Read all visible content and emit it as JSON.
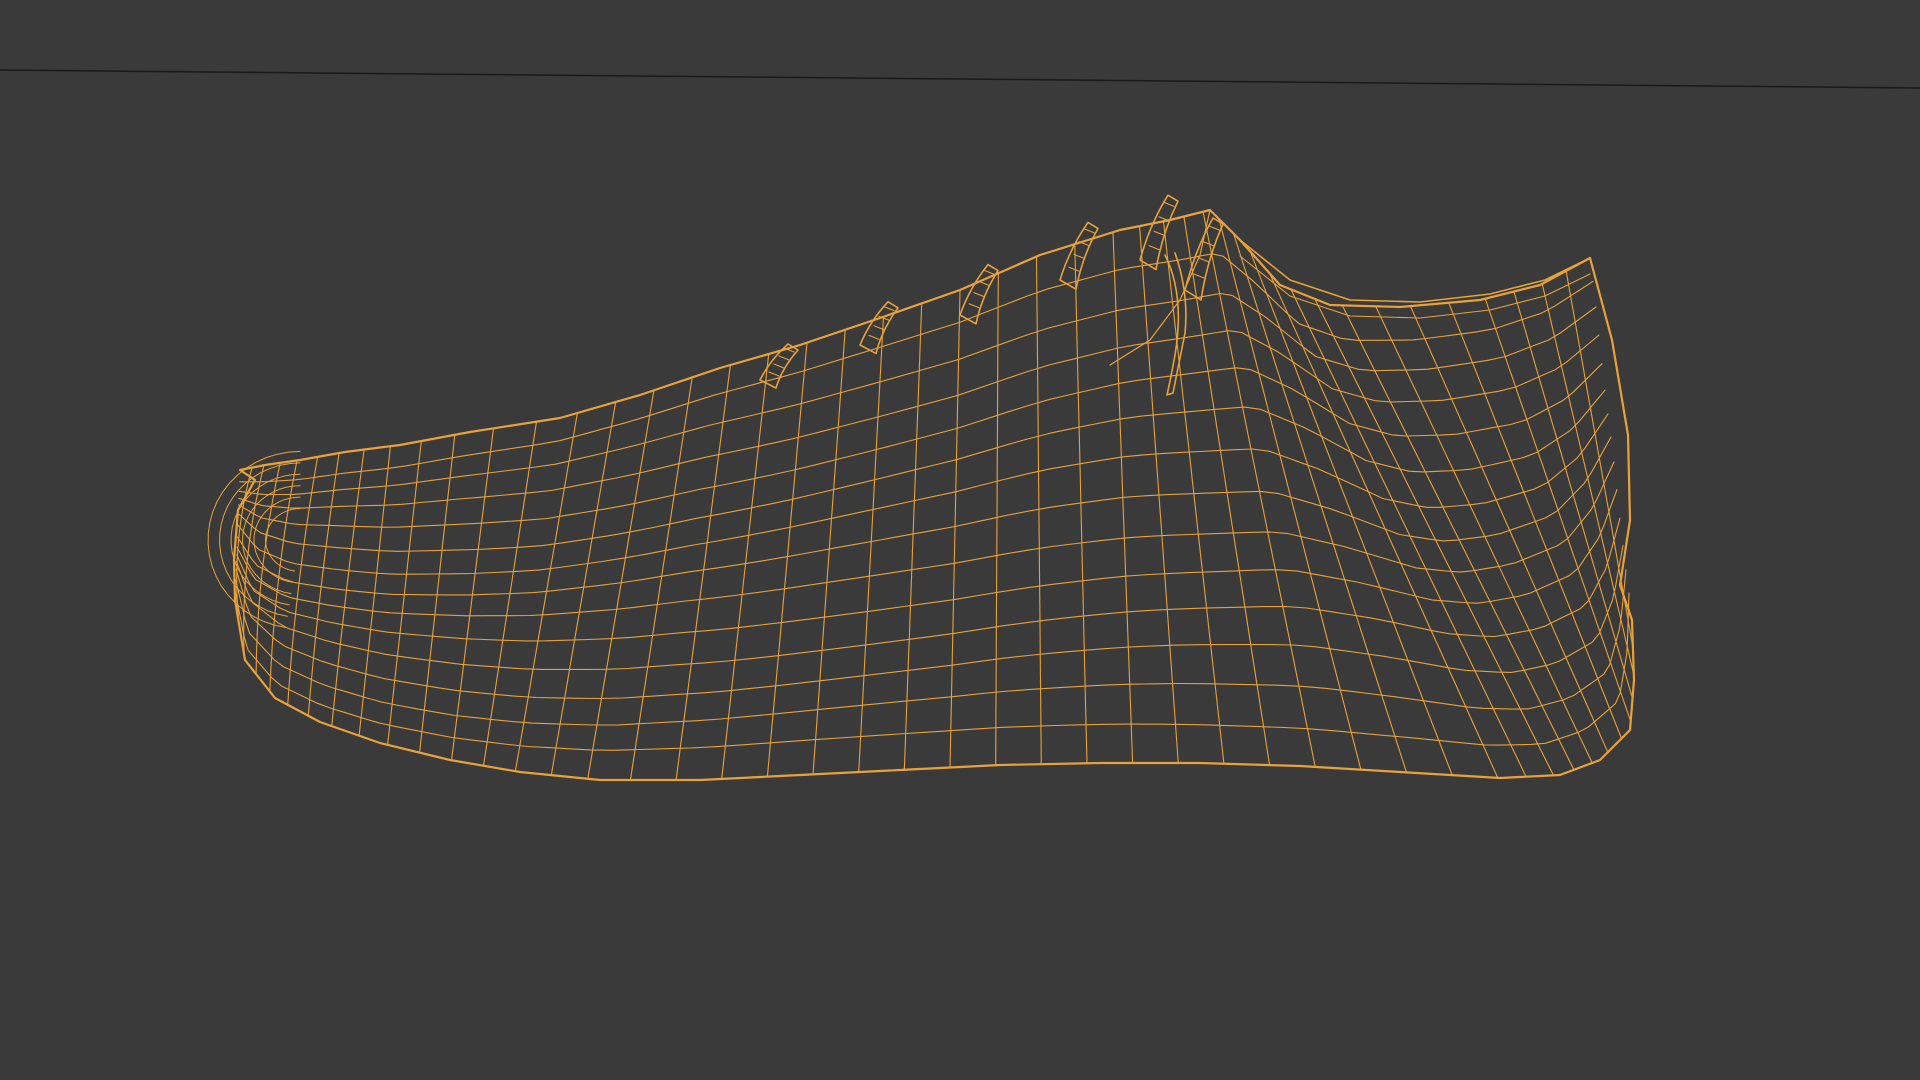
{
  "viewport": {
    "background_color": "#3a3a3a",
    "wire_color": "#e8a23a",
    "horizon_color": "#1a1a1a",
    "shading_mode": "wireframe",
    "selected_object": "shoe"
  }
}
